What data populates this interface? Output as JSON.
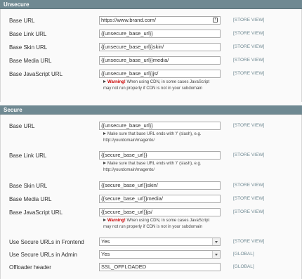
{
  "unsecure": {
    "title": "Unsecure",
    "rows": [
      {
        "label": "Base URL",
        "value": "https://www.brand.com/",
        "scope": "[STORE VIEW]"
      },
      {
        "label": "Base Link URL",
        "value": "{{unsecure_base_url}}",
        "scope": "[STORE VIEW]"
      },
      {
        "label": "Base Skin URL",
        "value": "{{unsecure_base_url}}skin/",
        "scope": "[STORE VIEW]"
      },
      {
        "label": "Base Media URL",
        "value": "{{unsecure_base_url}}media/",
        "scope": "[STORE VIEW]"
      },
      {
        "label": "Base JavaScript URL",
        "value": "{{unsecure_base_url}}js/",
        "scope": "[STORE VIEW]"
      }
    ],
    "js_note": {
      "warning": "Warning!",
      "line1": " When using CDN, in some cases JavaScript",
      "line2": "may not run properly if CDN is not in your subdomain"
    }
  },
  "secure": {
    "title": "Secure",
    "rows": [
      {
        "label": "Base URL",
        "value": "{{unsecure_base_url}}",
        "scope": "[STORE VIEW]"
      },
      {
        "label": "Base Link URL",
        "value": "{{secure_base_url}}",
        "scope": "[STORE VIEW]"
      },
      {
        "label": "Base Skin URL",
        "value": "{{secure_base_url}}skin/",
        "scope": "[STORE VIEW]"
      },
      {
        "label": "Base Media URL",
        "value": "{{secure_base_url}}media/",
        "scope": "[STORE VIEW]"
      },
      {
        "label": "Base JavaScript URL",
        "value": "{{secure_base_url}}js/",
        "scope": "[STORE VIEW]"
      },
      {
        "label": "Use Secure URLs in Frontend",
        "value": "Yes",
        "scope": "[STORE VIEW]"
      },
      {
        "label": "Use Secure URLs in Admin",
        "value": "Yes",
        "scope": "[GLOBAL]"
      },
      {
        "label": "Offloader header",
        "value": "SSL_OFFLOADED",
        "scope": "[GLOBAL]"
      }
    ],
    "slash_note": {
      "line1": "Make sure that base URL ends with '/' (slash), e.g.",
      "line2": "http://yourdomain/magento/"
    },
    "js_note": {
      "warning": "Warning!",
      "line1": " When using CDN, in some cases JavaScript",
      "line2": "may not run properly if CDN is not in your subdomain"
    }
  },
  "icons": {
    "base_url_field_icon": "key-icon",
    "note_bullet": "triangle-bullet-icon",
    "select_arrow": "chevron-down-icon"
  }
}
